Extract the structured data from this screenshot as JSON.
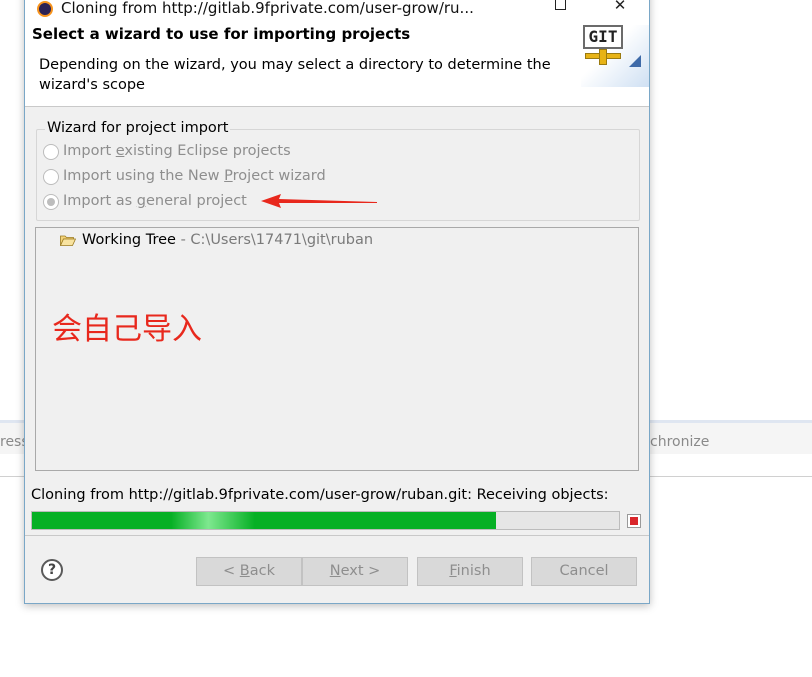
{
  "background": {
    "left_text": "ress",
    "right_text": "chronize"
  },
  "dialog": {
    "title": "Cloning from http://gitlab.9fprivate.com/user-grow/ru...",
    "maximize_icon": "maximize-icon",
    "close_icon": "close-icon",
    "close_glyph": "✕",
    "heading": "Select a wizard to use for importing projects",
    "description": "Depending on the wizard, you may select a directory to determine the wizard's scope",
    "logo_text": "GIT"
  },
  "wizard_group": {
    "legend": "Wizard for project import",
    "options": [
      {
        "pre": "Import ",
        "mn": "e",
        "post": "xisting Eclipse projects",
        "selected": false
      },
      {
        "pre": "Import using the New ",
        "mn": "P",
        "post": "roject wizard",
        "selected": false
      },
      {
        "pre": "Import as ",
        "mn": "g",
        "post": "eneral project",
        "selected": true
      }
    ]
  },
  "tree": {
    "node_name": "Working Tree",
    "node_path": " - C:\\Users\\17471\\git\\ruban",
    "annotation": "会自己导入"
  },
  "progress": {
    "label": "Cloning from http://gitlab.9fprivate.com/user-grow/ruban.git: Receiving objects:",
    "fraction": 0.79,
    "color": "#06b025"
  },
  "buttons": {
    "help": "?",
    "back_pre": "< ",
    "back_mn": "B",
    "back_post": "ack",
    "next_mn": "N",
    "next_post": "ext >",
    "finish_mn": "F",
    "finish_post": "inish",
    "cancel": "Cancel"
  },
  "colors": {
    "arrow": "#e8281d",
    "dialog_border": "#7aa7c7"
  }
}
